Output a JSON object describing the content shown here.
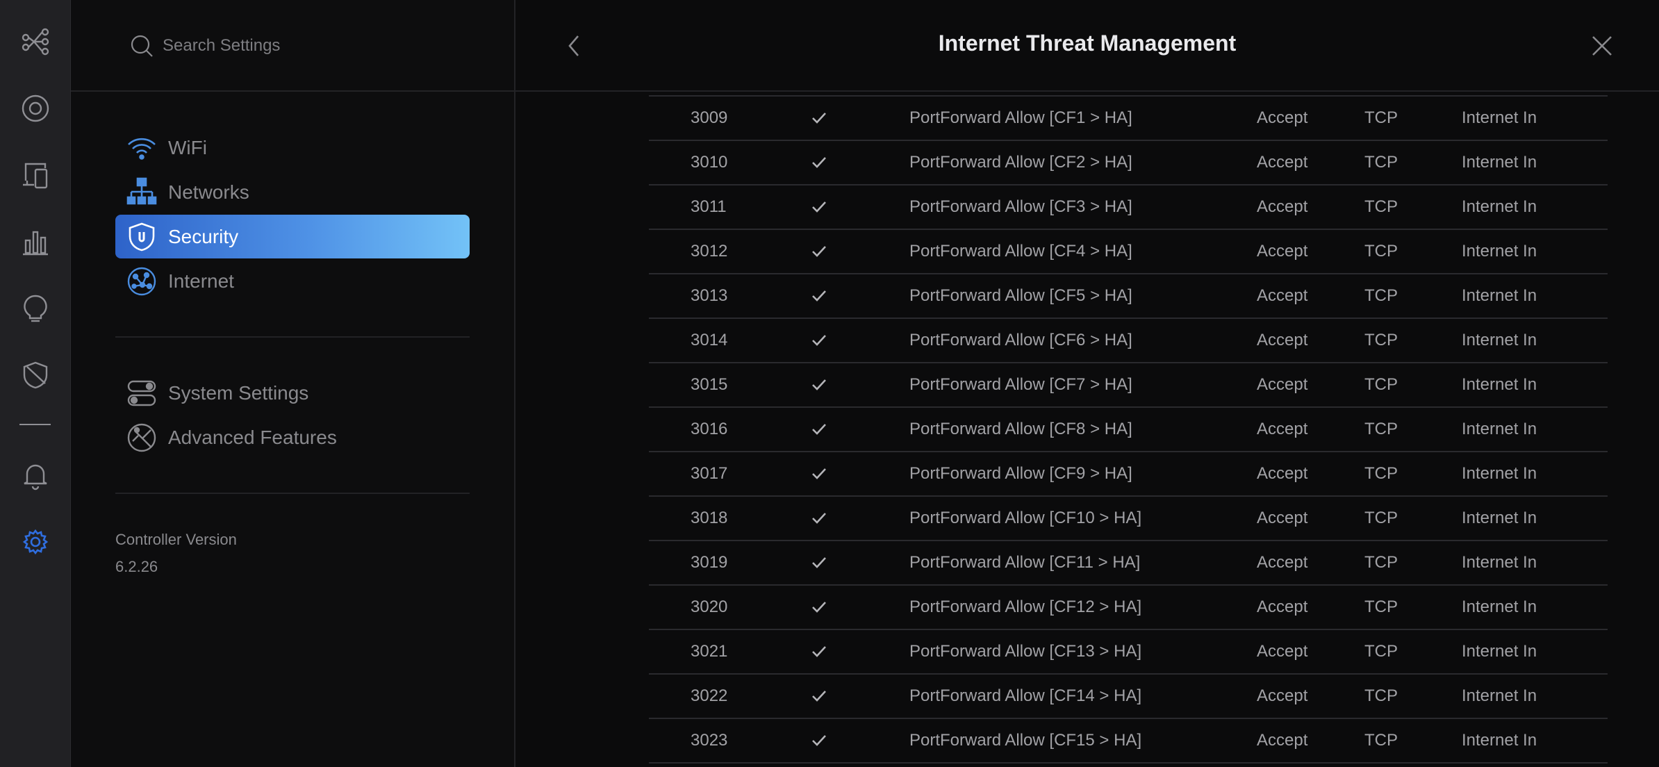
{
  "app": {
    "rail_icons": [
      "topology-icon",
      "devices-icon",
      "clients-icon",
      "statistics-icon",
      "insights-icon",
      "threat-icon",
      "alerts-icon",
      "settings-icon"
    ],
    "accent": "#2f6ee0"
  },
  "sidebar": {
    "search_placeholder": "Search Settings",
    "primary_items": [
      {
        "label": "WiFi",
        "icon": "wifi-icon"
      },
      {
        "label": "Networks",
        "icon": "networks-icon"
      },
      {
        "label": "Security",
        "icon": "shield-icon",
        "active": true
      },
      {
        "label": "Internet",
        "icon": "globe-icon"
      }
    ],
    "secondary_items": [
      {
        "label": "System Settings",
        "icon": "toggles-icon"
      },
      {
        "label": "Advanced Features",
        "icon": "tools-icon"
      }
    ],
    "controller_version_label": "Controller Version",
    "controller_version": "6.2.26"
  },
  "header": {
    "title": "Internet Threat Management"
  },
  "rules": [
    {
      "id": "3009",
      "enabled": true,
      "name": "PortForward Allow [CF1 > HA]",
      "action": "Accept",
      "protocol": "TCP",
      "type": "Internet In"
    },
    {
      "id": "3010",
      "enabled": true,
      "name": "PortForward Allow [CF2 > HA]",
      "action": "Accept",
      "protocol": "TCP",
      "type": "Internet In"
    },
    {
      "id": "3011",
      "enabled": true,
      "name": "PortForward Allow [CF3 > HA]",
      "action": "Accept",
      "protocol": "TCP",
      "type": "Internet In"
    },
    {
      "id": "3012",
      "enabled": true,
      "name": "PortForward Allow [CF4 > HA]",
      "action": "Accept",
      "protocol": "TCP",
      "type": "Internet In"
    },
    {
      "id": "3013",
      "enabled": true,
      "name": "PortForward Allow [CF5 > HA]",
      "action": "Accept",
      "protocol": "TCP",
      "type": "Internet In"
    },
    {
      "id": "3014",
      "enabled": true,
      "name": "PortForward Allow [CF6 > HA]",
      "action": "Accept",
      "protocol": "TCP",
      "type": "Internet In"
    },
    {
      "id": "3015",
      "enabled": true,
      "name": "PortForward Allow [CF7 > HA]",
      "action": "Accept",
      "protocol": "TCP",
      "type": "Internet In"
    },
    {
      "id": "3016",
      "enabled": true,
      "name": "PortForward Allow [CF8 > HA]",
      "action": "Accept",
      "protocol": "TCP",
      "type": "Internet In"
    },
    {
      "id": "3017",
      "enabled": true,
      "name": "PortForward Allow [CF9 > HA]",
      "action": "Accept",
      "protocol": "TCP",
      "type": "Internet In"
    },
    {
      "id": "3018",
      "enabled": true,
      "name": "PortForward Allow [CF10 > HA]",
      "action": "Accept",
      "protocol": "TCP",
      "type": "Internet In"
    },
    {
      "id": "3019",
      "enabled": true,
      "name": "PortForward Allow [CF11 > HA]",
      "action": "Accept",
      "protocol": "TCP",
      "type": "Internet In"
    },
    {
      "id": "3020",
      "enabled": true,
      "name": "PortForward Allow [CF12 > HA]",
      "action": "Accept",
      "protocol": "TCP",
      "type": "Internet In"
    },
    {
      "id": "3021",
      "enabled": true,
      "name": "PortForward Allow [CF13 > HA]",
      "action": "Accept",
      "protocol": "TCP",
      "type": "Internet In"
    },
    {
      "id": "3022",
      "enabled": true,
      "name": "PortForward Allow [CF14 > HA]",
      "action": "Accept",
      "protocol": "TCP",
      "type": "Internet In"
    },
    {
      "id": "3023",
      "enabled": true,
      "name": "PortForward Allow [CF15 > HA]",
      "action": "Accept",
      "protocol": "TCP",
      "type": "Internet In"
    }
  ]
}
